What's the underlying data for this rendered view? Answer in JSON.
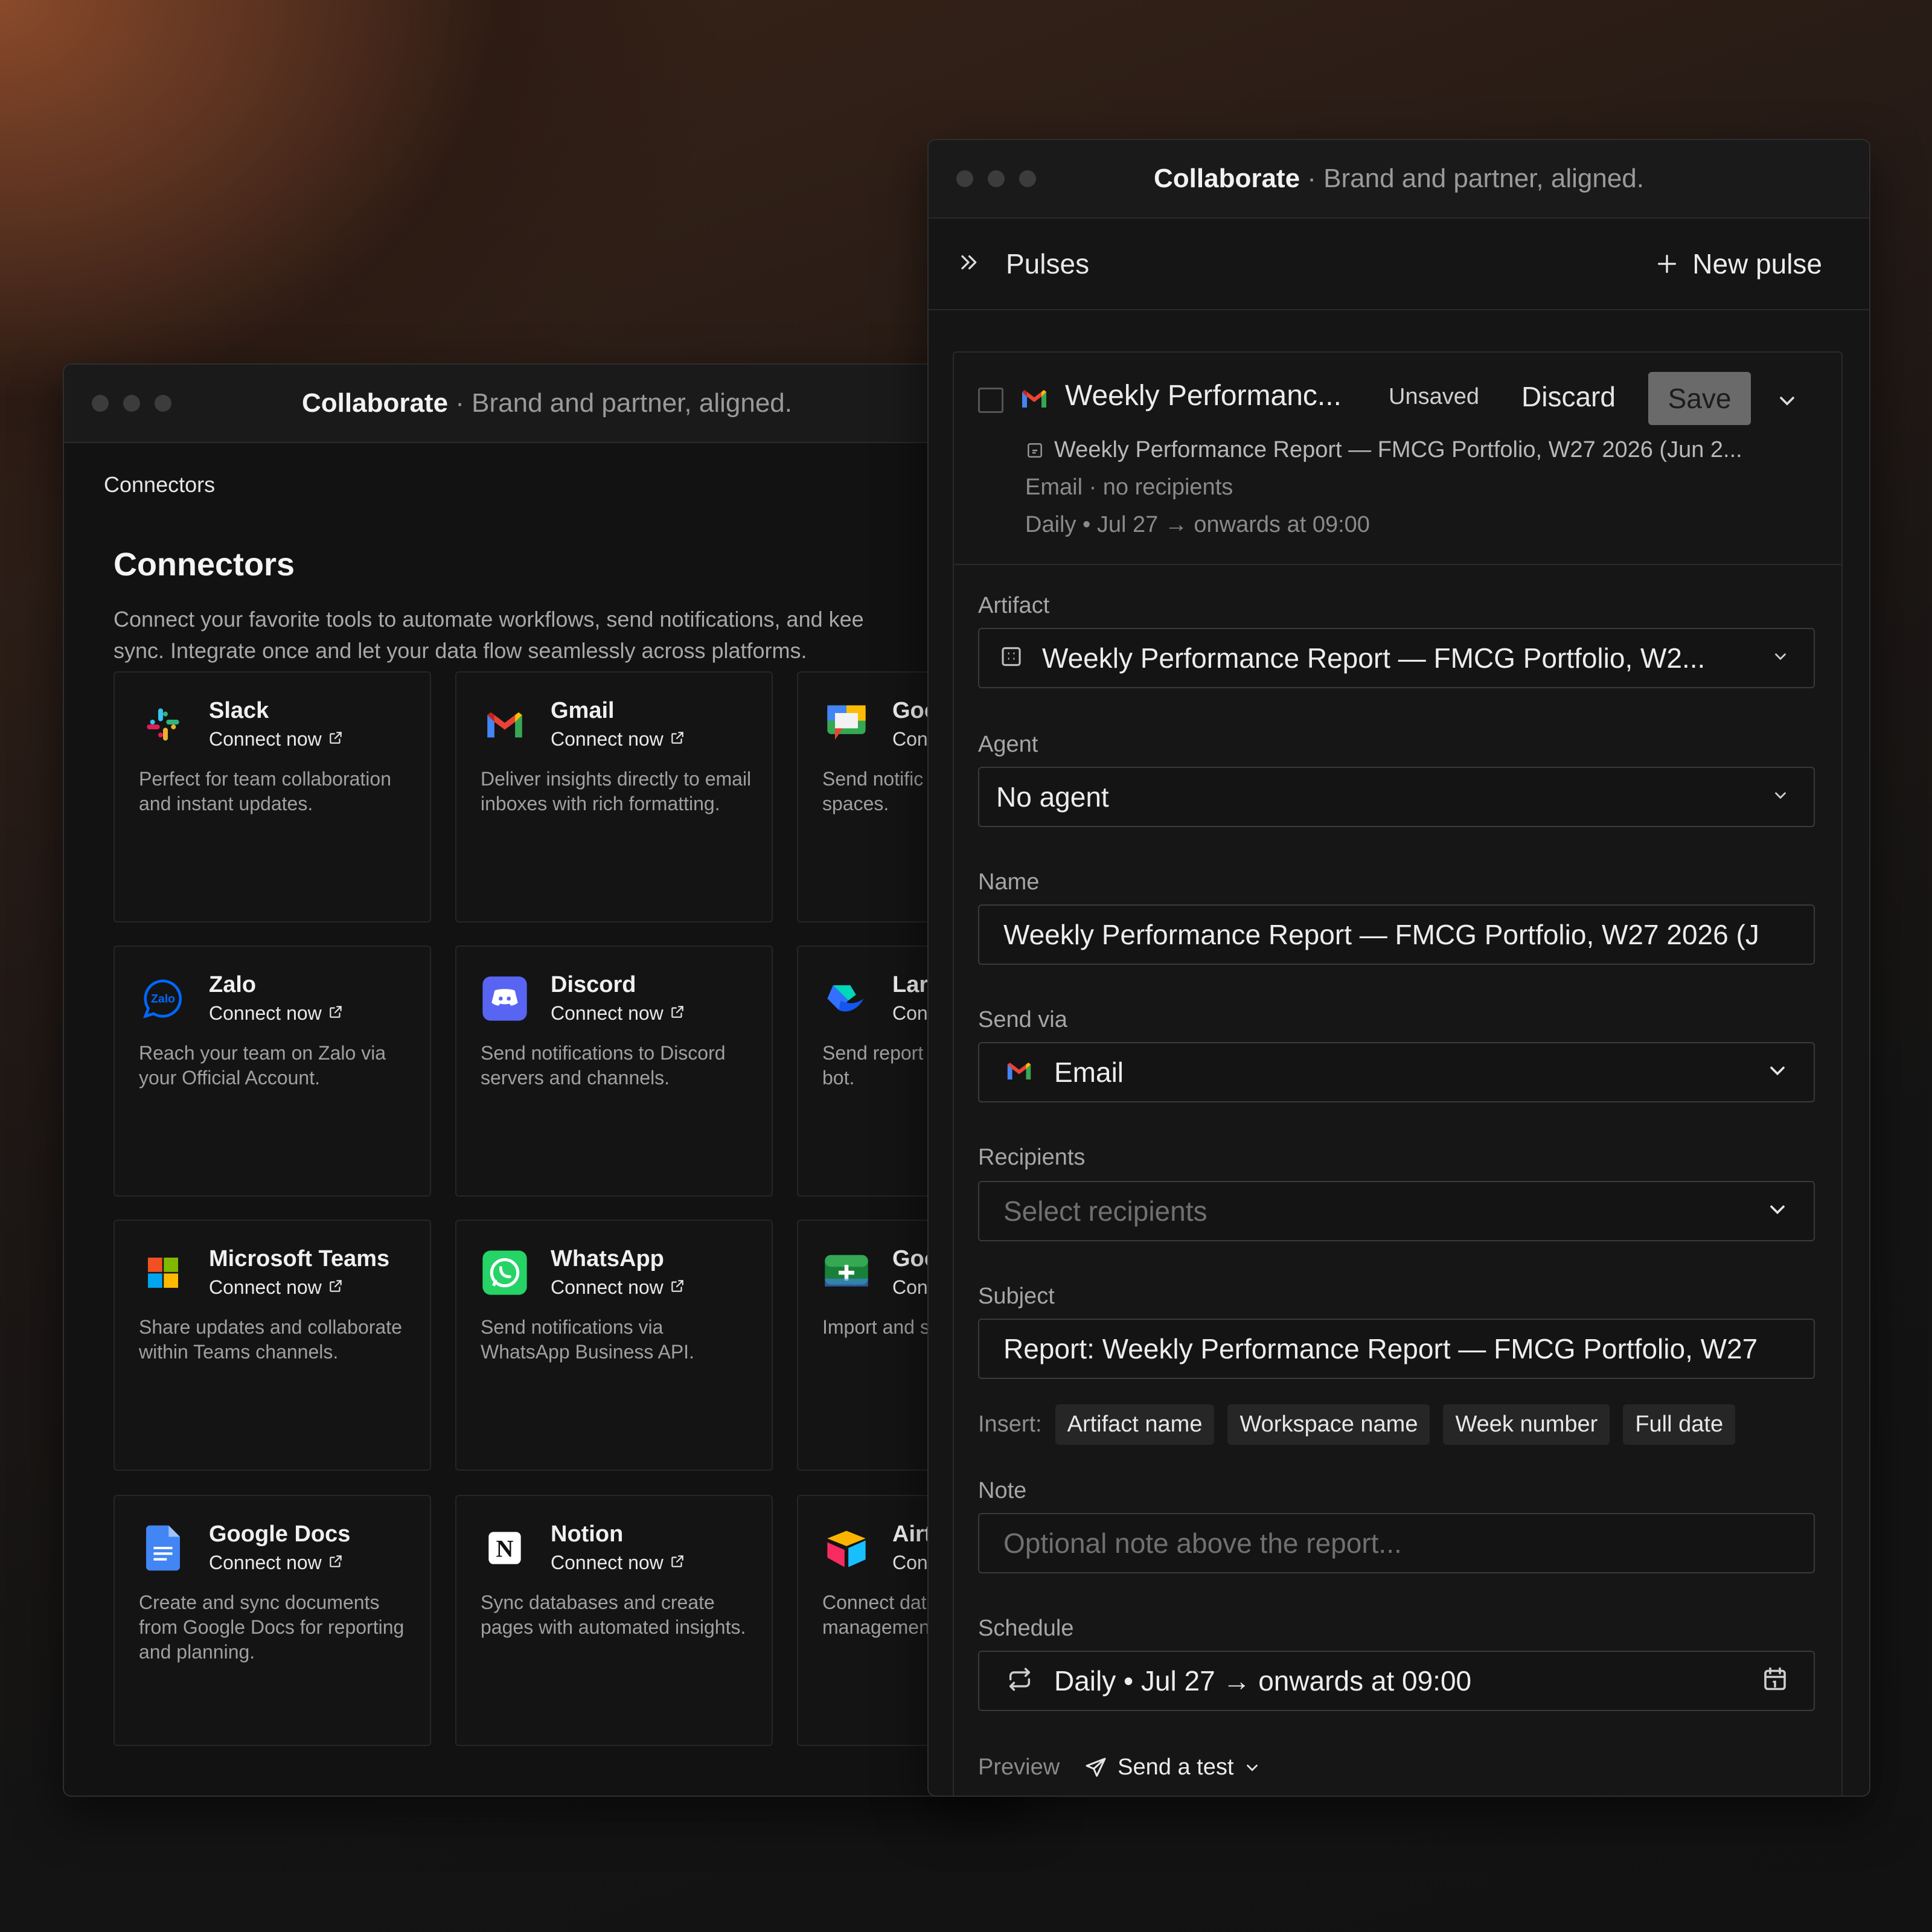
{
  "back_window": {
    "title_bold": "Collaborate",
    "title_rest": " · Brand and partner, aligned.",
    "breadcrumb": "Connectors",
    "heading": "Connectors",
    "description_line1": "Connect your favorite tools to automate workflows, send notifications, and kee",
    "description_line2": "sync. Integrate once and let your data flow seamlessly across platforms.",
    "connect_label": "Connect now",
    "cards": [
      {
        "name": "Slack",
        "icon": "slack-icon",
        "connect": "Connect now",
        "desc": "Perfect for team collaboration and instant updates."
      },
      {
        "name": "Gmail",
        "icon": "gmail-icon",
        "connect": "Connect now",
        "desc": "Deliver insights directly to email inboxes with rich formatting."
      },
      {
        "name": "Goo",
        "icon": "google-chat-icon",
        "connect": "Con",
        "desc": "Send notific reports to G spaces."
      },
      {
        "name": "Zalo",
        "icon": "zalo-icon",
        "connect": "Connect now",
        "desc": "Reach your team on Zalo via your Official Account."
      },
      {
        "name": "Discord",
        "icon": "discord-icon",
        "connect": "Connect now",
        "desc": "Send notifications to Discord servers and channels."
      },
      {
        "name": "Larl",
        "icon": "lark-icon",
        "connect": "Con",
        "desc": "Send report your Lark gr Epsilo bot."
      },
      {
        "name": "Microsoft Teams",
        "icon": "microsoft-teams-icon",
        "connect": "Connect now",
        "desc": "Share updates and collaborate within Teams channels."
      },
      {
        "name": "WhatsApp",
        "icon": "whatsapp-icon",
        "connect": "Connect now",
        "desc": "Send notifications via WhatsApp Business API."
      },
      {
        "name": "Goo",
        "icon": "google-sheets-icon",
        "connect": "Con",
        "desc": "Import and s Google Driv"
      },
      {
        "name": "Google Docs",
        "icon": "google-docs-icon",
        "connect": "Connect now",
        "desc": "Create and sync documents from Google Docs for reporting and planning."
      },
      {
        "name": "Notion",
        "icon": "notion-icon",
        "connect": "Connect now",
        "desc": "Sync databases and create pages with automated insights."
      },
      {
        "name": "Airt",
        "icon": "airtable-icon",
        "connect": "Con",
        "desc": "Connect dat automate re managemen"
      }
    ]
  },
  "front_window": {
    "title_bold": "Collaborate",
    "title_rest": " · Brand and partner, aligned.",
    "pulses_title": "Pulses",
    "new_pulse": "New pulse",
    "pulse": {
      "name": "Weekly Performanc...",
      "status": "Unsaved",
      "discard": "Discard",
      "save": "Save",
      "artifact_line": "Weekly Performance Report — FMCG Portfolio, W27 2026 (Jun 2...",
      "meta_channel": "Email · no recipients",
      "meta_schedule": "Daily • Jul 27 → onwards at 09:00"
    },
    "form": {
      "artifact_label": "Artifact",
      "artifact_value": "Weekly Performance Report — FMCG Portfolio, W2...",
      "agent_label": "Agent",
      "agent_value": "No agent",
      "name_label": "Name",
      "name_value": "Weekly Performance Report — FMCG Portfolio, W27 2026 (J",
      "sendvia_label": "Send via",
      "sendvia_value": "Email",
      "recipients_label": "Recipients",
      "recipients_placeholder": "Select recipients",
      "subject_label": "Subject",
      "subject_value": "Report: Weekly Performance Report — FMCG Portfolio, W27",
      "insert_label": "Insert:",
      "insert_chips": [
        "Artifact name",
        "Workspace name",
        "Week number",
        "Full date"
      ],
      "note_label": "Note",
      "note_placeholder": "Optional note above the report...",
      "schedule_label": "Schedule",
      "schedule_value": "Daily • Jul 27 → onwards at 09:00",
      "preview_label": "Preview",
      "send_test": "Send a test"
    }
  },
  "colors": {
    "background_glow": "#8a4a2a",
    "window_bg": "#161616",
    "save_button": "#6a6a6a"
  }
}
